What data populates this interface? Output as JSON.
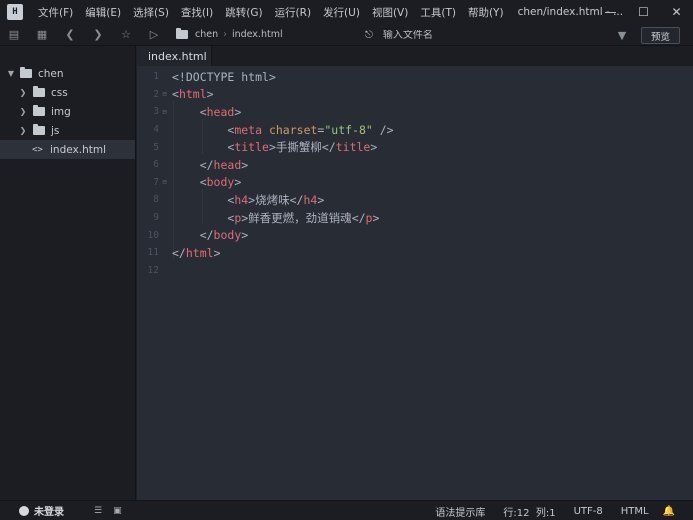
{
  "app": {
    "logo_text": "H",
    "window_title": "chen/index.html - ..."
  },
  "menu": [
    {
      "label": "文件(F)"
    },
    {
      "label": "编辑(E)"
    },
    {
      "label": "选择(S)"
    },
    {
      "label": "查找(I)"
    },
    {
      "label": "跳转(G)"
    },
    {
      "label": "运行(R)"
    },
    {
      "label": "发行(U)"
    },
    {
      "label": "视图(V)"
    },
    {
      "label": "工具(T)"
    },
    {
      "label": "帮助(Y)"
    }
  ],
  "toolbar": {
    "breadcrumb": [
      "chen",
      "index.html"
    ],
    "file_search_placeholder": "输入文件名",
    "preview_label": "预览"
  },
  "sidebar": {
    "root": "chen",
    "items": [
      {
        "label": "css",
        "type": "folder"
      },
      {
        "label": "img",
        "type": "folder"
      },
      {
        "label": "js",
        "type": "folder"
      },
      {
        "label": "index.html",
        "type": "file",
        "icon": "<>"
      }
    ]
  },
  "editor": {
    "tab": "index.html",
    "lines": [
      {
        "num": "1"
      },
      {
        "num": "2"
      },
      {
        "num": "3"
      },
      {
        "num": "4"
      },
      {
        "num": "5"
      },
      {
        "num": "6"
      },
      {
        "num": "7"
      },
      {
        "num": "8"
      },
      {
        "num": "9"
      },
      {
        "num": "10"
      },
      {
        "num": "11"
      },
      {
        "num": "12"
      }
    ],
    "code": {
      "l1": "<!DOCTYPE html>",
      "l2_tag": "html",
      "l3_tag": "head",
      "l4_tag": "meta",
      "l4_attr": "charset",
      "l4_val": "\"utf-8\"",
      "l5_tag": "title",
      "l5_text": "手撕蟹柳",
      "l7_tag": "body",
      "l8_tag": "h4",
      "l8_text": "烧烤味",
      "l9_tag": "p",
      "l9_text": "鲜香更燃，劲道销魂"
    }
  },
  "statusbar": {
    "user": "未登录",
    "syntax_lib": "语法提示库",
    "position": "行:12  列:1",
    "encoding": "UTF-8",
    "language": "HTML"
  }
}
